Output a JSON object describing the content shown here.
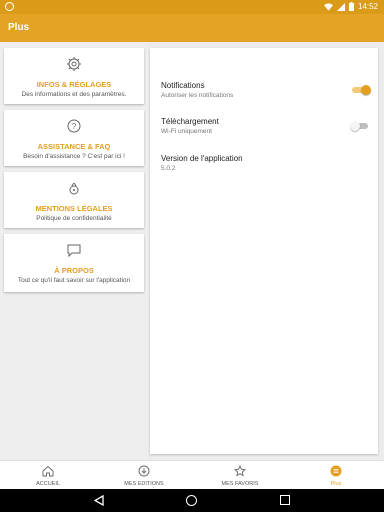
{
  "status_bar": {
    "time": "14:52"
  },
  "app_bar": {
    "title": "Plus"
  },
  "menu": [
    {
      "title": "INFOS & RÉGLAGES",
      "subtitle": "Des informations et des paramètres."
    },
    {
      "title": "ASSISTANCE & FAQ",
      "subtitle": "Besoin d'assistance ? C'est par ici !"
    },
    {
      "title": "MENTIONS LÉGALES",
      "subtitle": "Politique de confidentialité"
    },
    {
      "title": "À PROPOS",
      "subtitle": "Tout ce qu'il faut savoir sur l'application"
    }
  ],
  "settings": [
    {
      "title": "Notifications",
      "subtitle": "Autoriser les notifications",
      "toggle": "on"
    },
    {
      "title": "Téléchargement",
      "subtitle": "Wi-Fi uniquement",
      "toggle": "off"
    },
    {
      "title": "Version de l'application",
      "subtitle": "5.0.2"
    }
  ],
  "bottom_nav": [
    {
      "label": "ACCUEIL",
      "icon": "home-icon"
    },
    {
      "label": "MES EDITIONS",
      "icon": "download-icon"
    },
    {
      "label": "MES FAVORIS",
      "icon": "star-icon"
    },
    {
      "label": "Plus",
      "icon": "menu-icon",
      "active": true
    }
  ],
  "colors": {
    "accent": "#e3a425",
    "status_bar": "#d99b18"
  }
}
